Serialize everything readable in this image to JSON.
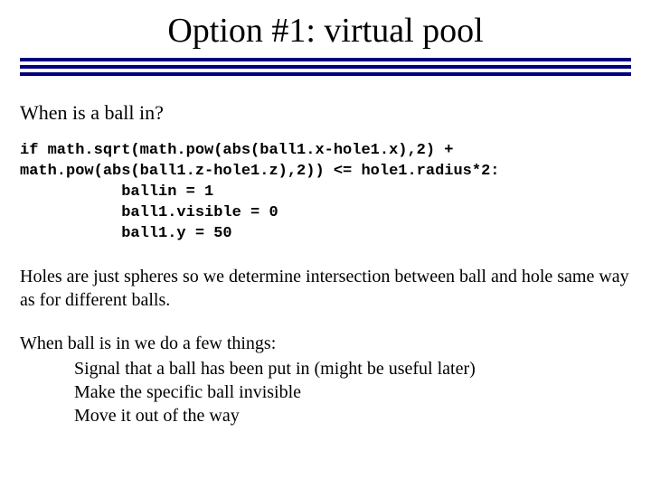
{
  "title": "Option #1:  virtual pool",
  "heading": "When is a ball in?",
  "code": {
    "l1": "if math.sqrt(math.pow(abs(ball1.x-hole1.x),2) +",
    "l2": "math.pow(abs(ball1.z-hole1.z),2)) <= hole1.radius*2:",
    "l3": "           ballin = 1",
    "l4": "           ball1.visible = 0",
    "l5": "           ball1.y = 50"
  },
  "para1": "Holes are just spheres so we determine intersection between ball and hole same way as for  different balls.",
  "para2_intro": "When ball is in we do a few things:",
  "para2_items": {
    "a": "Signal that a ball has been put in (might be useful later)",
    "b": "Make the specific ball invisible",
    "c": "Move it out of the way"
  }
}
